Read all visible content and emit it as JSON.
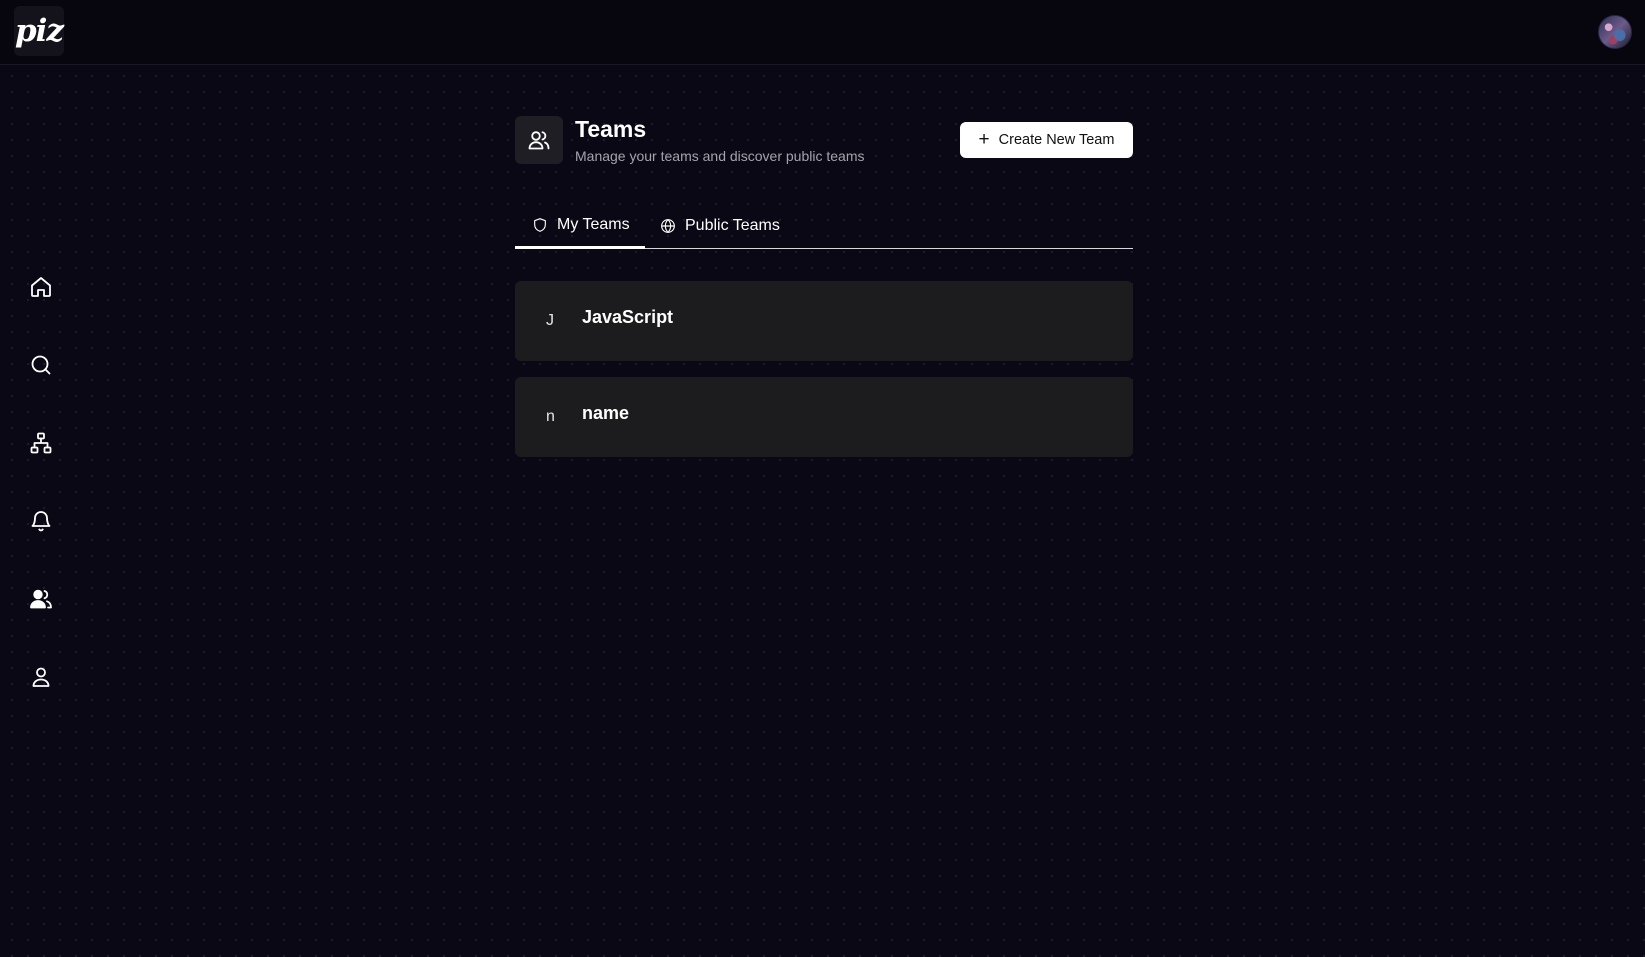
{
  "app": {
    "logo_text": "piz"
  },
  "topbar": {
    "avatar_icon": "user-avatar"
  },
  "sidebar": {
    "items": [
      {
        "name": "home",
        "icon": "home-icon"
      },
      {
        "name": "search",
        "icon": "search-icon"
      },
      {
        "name": "network",
        "icon": "network-icon"
      },
      {
        "name": "notifications",
        "icon": "bell-icon"
      },
      {
        "name": "teams",
        "icon": "users-icon"
      },
      {
        "name": "profile",
        "icon": "user-icon"
      }
    ]
  },
  "header": {
    "icon": "users-icon",
    "title": "Teams",
    "subtitle": "Manage your teams and discover public teams",
    "create_button_label": "Create New Team"
  },
  "tabs": [
    {
      "label": "My Teams",
      "icon": "shield-icon",
      "active": true
    },
    {
      "label": "Public Teams",
      "icon": "globe-icon",
      "active": false
    }
  ],
  "teams": [
    {
      "initial": "J",
      "name": "JavaScript"
    },
    {
      "initial": "n",
      "name": "name"
    }
  ]
}
